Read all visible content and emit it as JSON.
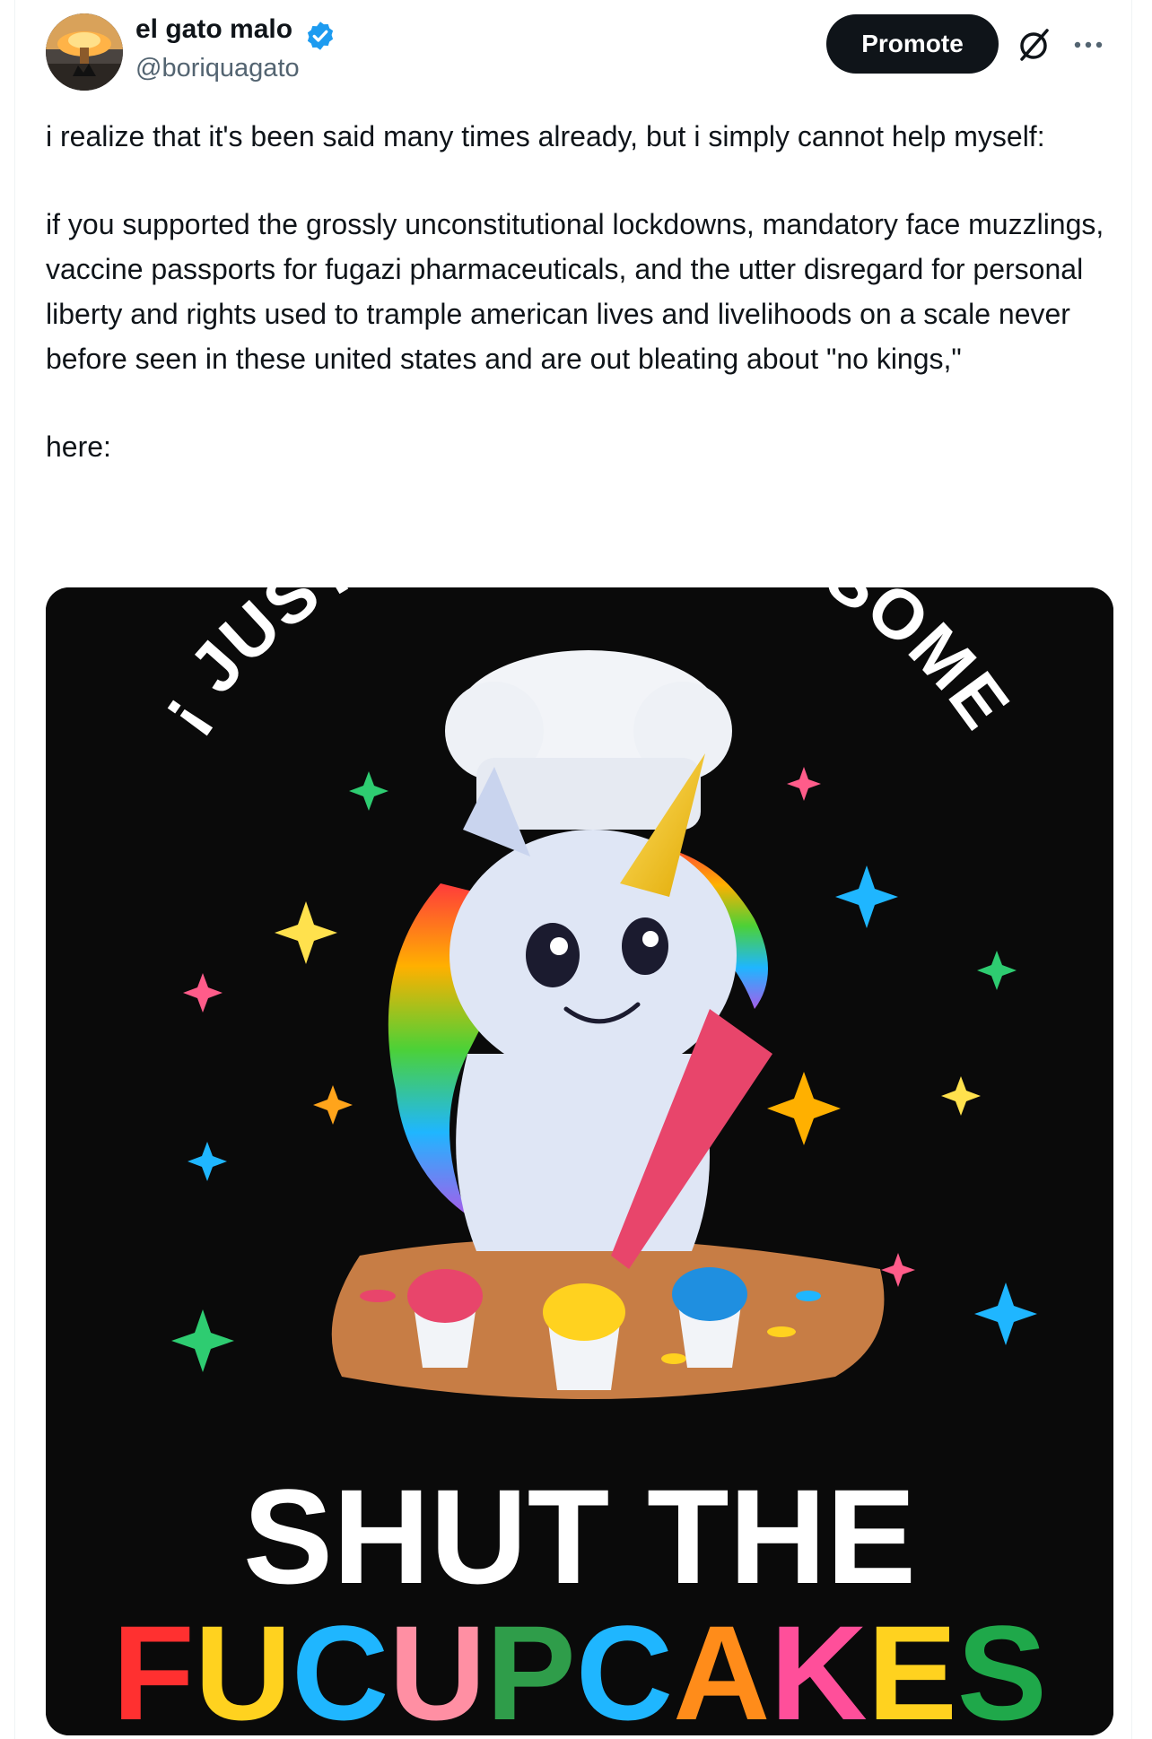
{
  "post": {
    "author": {
      "display_name": "el gato malo",
      "handle": "@boriquagato",
      "verified": true,
      "verified_color": "#1d9bf0"
    },
    "actions": {
      "promote_label": "Promote",
      "grok_icon": "grok-icon",
      "more_icon": "more-options-icon"
    },
    "text": {
      "paragraph_1": "i realize that it's been said many times already, but i simply cannot help myself:",
      "paragraph_2": "if you supported the grossly unconstitutional lockdowns, mandatory face muzzlings, vaccine passports for fugazi pharmaceuticals, and the utter disregard for personal liberty and rights used to trample american lives and livelihoods on a scale never before seen in these united states and are out bleating about \"no kings,\"",
      "paragraph_3": "here:"
    },
    "image": {
      "top_text": "¡ JUST BAKED YOU SOME",
      "line_1": "SHUT THE",
      "line_2": "FUCUPCAKES",
      "line_2_colors": [
        "#ff3030",
        "#ffd21f",
        "#1fb6ff",
        "#ff8fa3",
        "#2f9d4a",
        "#1fb6ff",
        "#ff8c1a",
        "#ff4f9a",
        "#ffd21f",
        "#1fa84a"
      ],
      "background_color": "#0a0a0a"
    }
  }
}
